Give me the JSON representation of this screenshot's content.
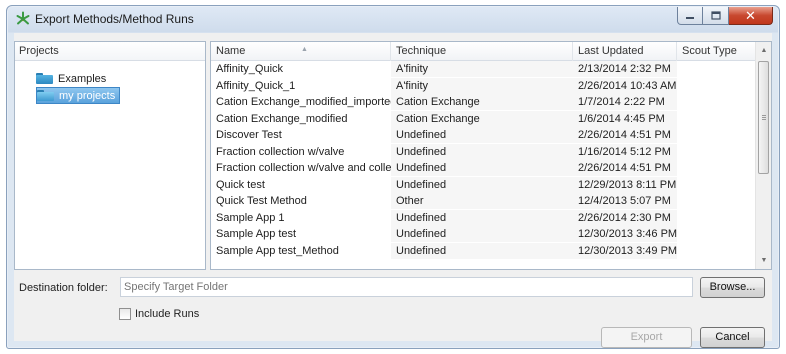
{
  "window": {
    "title": "Export Methods/Method Runs",
    "icon": "app-icon"
  },
  "projects": {
    "header": "Projects",
    "items": [
      {
        "label": "Examples",
        "icon": "folder-icon",
        "selected": false
      },
      {
        "label": "my projects",
        "icon": "folder-icon",
        "selected": true
      }
    ]
  },
  "table": {
    "columns": [
      "Name",
      "Technique",
      "Last Updated",
      "Scout Type"
    ],
    "rows": [
      [
        "Affinity_Quick",
        "A'finity",
        "2/13/2014 2:32 PM",
        ""
      ],
      [
        "Affinity_Quick_1",
        "A'finity",
        "2/26/2014 10:43 AM",
        ""
      ],
      [
        "Cation Exchange_modified_imported",
        "Cation Exchange",
        "1/7/2014 2:22 PM",
        ""
      ],
      [
        "Cation Exchange_modified",
        "Cation Exchange",
        "1/6/2014 4:45 PM",
        ""
      ],
      [
        "Discover Test",
        "Undefined",
        "2/26/2014 4:51 PM",
        ""
      ],
      [
        "Fraction collection w/valve",
        "Undefined",
        "1/16/2014 5:12 PM",
        ""
      ],
      [
        "Fraction collection w/valve and collec",
        "Undefined",
        "2/26/2014 4:51 PM",
        ""
      ],
      [
        "Quick test",
        "Undefined",
        "12/29/2013 8:11 PM",
        ""
      ],
      [
        "Quick Test Method",
        "Other",
        "12/4/2013 5:07 PM",
        ""
      ],
      [
        "Sample App 1",
        "Undefined",
        "2/26/2014 2:30 PM",
        ""
      ],
      [
        "Sample App test",
        "Undefined",
        "12/30/2013 3:46 PM",
        ""
      ],
      [
        "Sample App test_Method",
        "Undefined",
        "12/30/2013 3:49 PM",
        ""
      ]
    ]
  },
  "destination": {
    "label": "Destination folder:",
    "placeholder": "Specify Target Folder",
    "value": ""
  },
  "include_runs": {
    "label": "Include Runs",
    "checked": false
  },
  "buttons": {
    "browse": "Browse...",
    "export": "Export",
    "cancel": "Cancel"
  },
  "colors": {
    "selection": "#5aa2dc",
    "close_button": "#c8482f",
    "frame": "#cfdcec"
  }
}
